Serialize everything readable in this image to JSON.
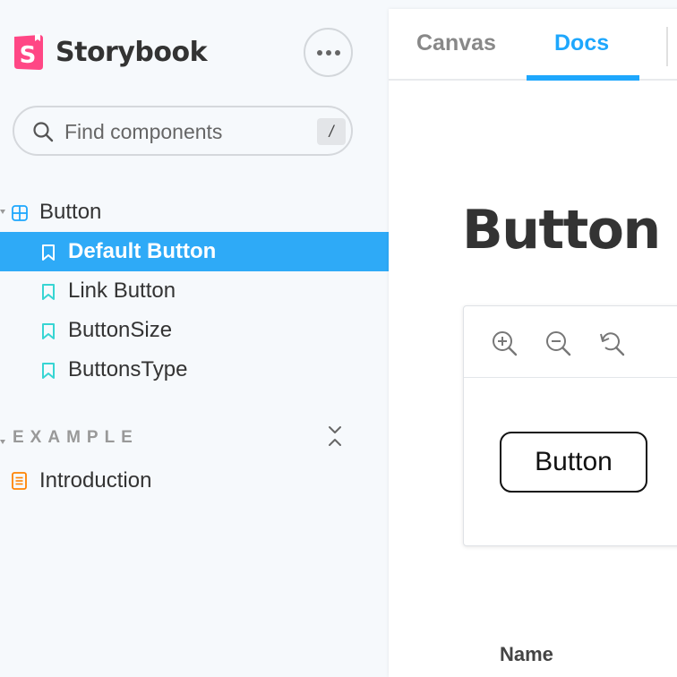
{
  "brand": {
    "name": "Storybook",
    "logo_color": "#ff4785"
  },
  "search": {
    "placeholder": "Find components",
    "shortcut": "/"
  },
  "tree": {
    "component": {
      "label": "Button",
      "icon": "component-icon"
    },
    "stories": [
      {
        "label": "Default Button",
        "selected": true
      },
      {
        "label": "Link Button",
        "selected": false
      },
      {
        "label": "ButtonSize",
        "selected": false
      },
      {
        "label": "ButtonsType",
        "selected": false
      }
    ]
  },
  "group": {
    "label": "EXAMPLE",
    "items": [
      {
        "label": "Introduction",
        "icon": "document-icon"
      }
    ]
  },
  "tabs": [
    {
      "label": "Canvas",
      "active": false
    },
    {
      "label": "Docs",
      "active": true
    }
  ],
  "docs": {
    "title": "Button",
    "preview_button_label": "Button",
    "args_table_header": "Name"
  },
  "colors": {
    "accent": "#1ea7fd",
    "selected_bg": "#2eaaf7",
    "story_icon": "#37d5d3",
    "doc_icon": "#ff8300"
  }
}
